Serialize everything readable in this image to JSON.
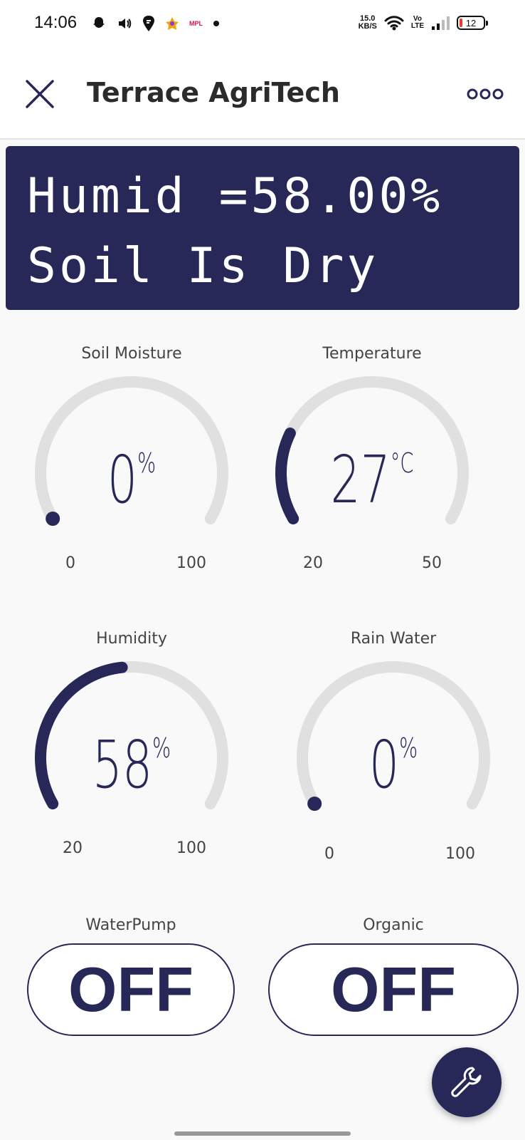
{
  "status_bar": {
    "time": "14:06",
    "mpl": "MPL",
    "net_speed_value": "15.0",
    "net_speed_unit": "KB/S",
    "volte_top": "Vo",
    "volte_bottom": "LTE",
    "battery": "12",
    "icons_left": [
      "snapchat-icon",
      "volume-icon",
      "swiggy-icon",
      "star-app-icon",
      "mpl-icon",
      "dot-icon"
    ],
    "icons_right": [
      "wifi-icon",
      "signal-icon",
      "battery-icon"
    ]
  },
  "app_bar": {
    "title": "Terrace AgriTech",
    "close_icon": "close-icon",
    "more_icon": "more-dots-icon"
  },
  "lcd": {
    "line1": "Humid =58.00%",
    "line2": "Soil Is Dry"
  },
  "gauges": [
    {
      "label": "Soil Moisture",
      "value": "0",
      "unit": "%",
      "min": "0",
      "max": "100",
      "fraction": 0
    },
    {
      "label": "Temperature",
      "value": "27",
      "unit": "°C",
      "min": "20",
      "max": "50",
      "fraction": 0.233
    },
    {
      "label": "Humidity",
      "value": "58",
      "unit": "%",
      "min": "20",
      "max": "100",
      "fraction": 0.475
    },
    {
      "label": "Rain Water",
      "value": "0",
      "unit": "%",
      "min": "0",
      "max": "100",
      "fraction": 0
    }
  ],
  "switches": [
    {
      "label": "WaterPump",
      "state": "OFF"
    },
    {
      "label": "Organic",
      "state": "OFF"
    }
  ],
  "fab": {
    "icon": "wrench-icon"
  },
  "colors": {
    "accent": "#272858",
    "track": "#e0e0e0",
    "background": "#f9f9f9"
  }
}
